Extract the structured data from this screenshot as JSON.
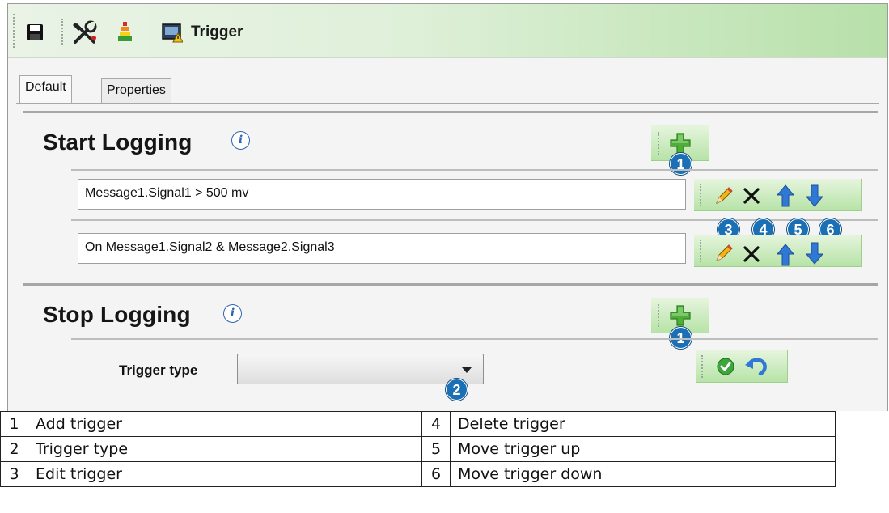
{
  "toolbar": {
    "title": "Trigger",
    "icons": [
      "save-icon",
      "tools-icon",
      "level-icon",
      "monitor-warning-icon"
    ]
  },
  "tabs": [
    {
      "label": "Default",
      "active": true
    },
    {
      "label": "Properties",
      "active": false
    }
  ],
  "start": {
    "title": "Start Logging",
    "triggers": [
      "Message1.Signal1  >  500 mv",
      "On Message1.Signal2 & Message2.Signal3"
    ]
  },
  "stop": {
    "title": "Stop Logging",
    "trigger_type_label": "Trigger type",
    "trigger_type_value": ""
  },
  "badges": {
    "add": "1",
    "type": "2",
    "edit": "3",
    "delete": "4",
    "up": "5",
    "down": "6"
  },
  "legend": [
    {
      "n1": "1",
      "l1": "Add trigger",
      "n2": "4",
      "l2": "Delete trigger"
    },
    {
      "n1": "2",
      "l1": "Trigger type",
      "n2": "5",
      "l2": "Move trigger up"
    },
    {
      "n1": "3",
      "l1": "Edit trigger",
      "n2": "6",
      "l2": "Move trigger down"
    }
  ],
  "colors": {
    "accent_green": "#b7e3a7",
    "badge_blue": "#1b6fb5",
    "arrow_blue": "#2f78d6"
  }
}
